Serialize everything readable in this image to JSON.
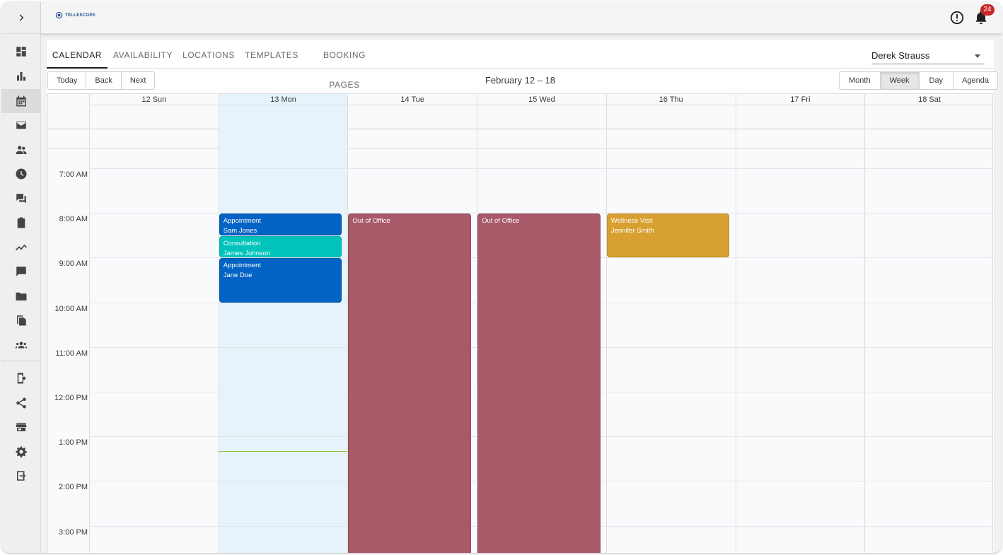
{
  "brand": {
    "logo_text": "TELLESCOPE",
    "accent": "#1a4a8a"
  },
  "sidebar": {
    "toggle_icon": "chevron-right-icon",
    "items": [
      {
        "icon": "dashboard-icon"
      },
      {
        "icon": "bar-chart-icon"
      },
      {
        "icon": "calendar-icon",
        "active": true
      },
      {
        "icon": "mail-icon"
      },
      {
        "icon": "people-icon"
      },
      {
        "icon": "clock-icon"
      },
      {
        "icon": "forum-icon"
      },
      {
        "icon": "clipboard-icon"
      },
      {
        "icon": "trend-icon"
      },
      {
        "icon": "chat-icon"
      },
      {
        "icon": "folder-icon"
      },
      {
        "icon": "file-copy-icon"
      },
      {
        "icon": "groups-icon"
      },
      {
        "icon": "app-settings-icon"
      },
      {
        "icon": "share-icon"
      },
      {
        "icon": "store-icon"
      },
      {
        "icon": "gear-icon"
      },
      {
        "icon": "logout-icon"
      }
    ]
  },
  "topbar": {
    "notification_count": "24"
  },
  "tabs": [
    {
      "label": "CALENDAR",
      "active": true
    },
    {
      "label": "AVAILABILITY"
    },
    {
      "label": "LOCATIONS"
    },
    {
      "label": "TEMPLATES"
    },
    {
      "label": "BOOKING PAGES"
    }
  ],
  "user_select": {
    "value": "Derek Strauss"
  },
  "toolbar": {
    "nav": [
      "Today",
      "Back",
      "Next"
    ],
    "range_label": "February 12 – 18",
    "views": [
      {
        "label": "Month"
      },
      {
        "label": "Week",
        "active": true
      },
      {
        "label": "Day"
      },
      {
        "label": "Agenda"
      }
    ]
  },
  "calendar": {
    "days": [
      {
        "label": "12 Sun"
      },
      {
        "label": "13 Mon",
        "today": true
      },
      {
        "label": "14 Tue"
      },
      {
        "label": "15 Wed"
      },
      {
        "label": "16 Thu"
      },
      {
        "label": "17 Fri"
      },
      {
        "label": "18 Sat"
      }
    ],
    "times": [
      "7:00 AM",
      "8:00 AM",
      "9:00 AM",
      "10:00 AM",
      "11:00 AM",
      "12:00 PM",
      "1:00 PM",
      "2:00 PM",
      "3:00 PM"
    ],
    "events": [
      {
        "title": "Appointment",
        "person": "Sam Jones",
        "day": 1,
        "start": 8.0,
        "end": 8.5,
        "color": "blue"
      },
      {
        "title": "Consultation",
        "person": "James Johnson",
        "day": 1,
        "start": 8.5,
        "end": 9.0,
        "color": "teal"
      },
      {
        "title": "Appointment",
        "person": "Jane Doe",
        "day": 1,
        "start": 9.0,
        "end": 10.0,
        "color": "blue"
      },
      {
        "title": "Out of Office",
        "person": "",
        "day": 2,
        "start": 8.0,
        "end": 16.0,
        "color": "red"
      },
      {
        "title": "Out of Office",
        "person": "",
        "day": 3,
        "start": 8.0,
        "end": 16.0,
        "color": "red"
      },
      {
        "title": "Wellness Visit",
        "person": "Jennifer Smith",
        "day": 4,
        "start": 8.0,
        "end": 9.0,
        "color": "gold"
      }
    ],
    "now_time": 13.33
  }
}
